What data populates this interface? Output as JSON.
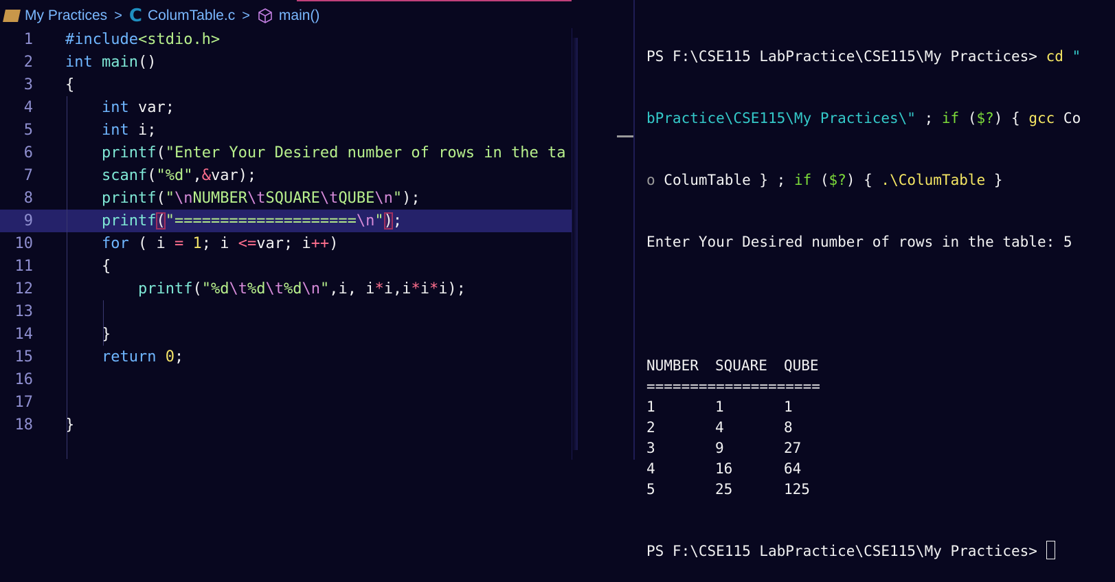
{
  "breadcrumb": {
    "folder": "My Practices",
    "file": "ColumTable.c",
    "symbol": "main()"
  },
  "editor": {
    "highlighted_line": 9,
    "lines": [
      [
        [
          "kw",
          "#include"
        ],
        [
          "str",
          "<stdio.h>"
        ]
      ],
      [
        [
          "kw",
          "int"
        ],
        [
          "pl",
          " "
        ],
        [
          "fn",
          "main"
        ],
        [
          "pl",
          "()"
        ]
      ],
      [
        [
          "pl",
          "{"
        ]
      ],
      [
        [
          "pl",
          "    "
        ],
        [
          "kw",
          "int"
        ],
        [
          "pl",
          " var;"
        ]
      ],
      [
        [
          "pl",
          "    "
        ],
        [
          "kw",
          "int"
        ],
        [
          "pl",
          " i;"
        ]
      ],
      [
        [
          "pl",
          "    "
        ],
        [
          "fn",
          "printf"
        ],
        [
          "pl",
          "("
        ],
        [
          "str",
          "\"Enter Your Desired number of rows in the ta"
        ]
      ],
      [
        [
          "pl",
          "    "
        ],
        [
          "fn",
          "scanf"
        ],
        [
          "pl",
          "("
        ],
        [
          "str",
          "\"%d\""
        ],
        [
          "pl",
          ","
        ],
        [
          "op",
          "&"
        ],
        [
          "pl",
          "var);"
        ]
      ],
      [
        [
          "pl",
          "    "
        ],
        [
          "fn",
          "printf"
        ],
        [
          "pl",
          "("
        ],
        [
          "str",
          "\""
        ],
        [
          "esc",
          "\\n"
        ],
        [
          "str",
          "NUMBER"
        ],
        [
          "esc",
          "\\t"
        ],
        [
          "str",
          "SQUARE"
        ],
        [
          "esc",
          "\\t"
        ],
        [
          "str",
          "QUBE"
        ],
        [
          "esc",
          "\\n"
        ],
        [
          "str",
          "\""
        ],
        [
          "pl",
          ");"
        ]
      ],
      [
        [
          "pl",
          "    "
        ],
        [
          "fn",
          "printf"
        ],
        [
          "br",
          "("
        ],
        [
          "str",
          "\"===================="
        ],
        [
          "esc",
          "\\n"
        ],
        [
          "str",
          "\""
        ],
        [
          "br",
          ")"
        ],
        [
          "pl",
          ";"
        ]
      ],
      [
        [
          "pl",
          "    "
        ],
        [
          "kw",
          "for"
        ],
        [
          "pl",
          " ( i "
        ],
        [
          "op",
          "="
        ],
        [
          "pl",
          " "
        ],
        [
          "num",
          "1"
        ],
        [
          "pl",
          "; i "
        ],
        [
          "op",
          "<="
        ],
        [
          "pl",
          "var; i"
        ],
        [
          "op",
          "++"
        ],
        [
          "pl",
          ")"
        ]
      ],
      [
        [
          "pl",
          "    {"
        ]
      ],
      [
        [
          "pl",
          "        "
        ],
        [
          "fn",
          "printf"
        ],
        [
          "pl",
          "("
        ],
        [
          "str",
          "\"%d"
        ],
        [
          "esc",
          "\\t"
        ],
        [
          "str",
          "%d"
        ],
        [
          "esc",
          "\\t"
        ],
        [
          "str",
          "%d"
        ],
        [
          "esc",
          "\\n"
        ],
        [
          "str",
          "\""
        ],
        [
          "pl",
          ",i, i"
        ],
        [
          "op",
          "*"
        ],
        [
          "pl",
          "i,i"
        ],
        [
          "op",
          "*"
        ],
        [
          "pl",
          "i"
        ],
        [
          "op",
          "*"
        ],
        [
          "pl",
          "i);"
        ]
      ],
      [],
      [
        [
          "pl",
          "    }"
        ]
      ],
      [
        [
          "pl",
          "    "
        ],
        [
          "kw",
          "return"
        ],
        [
          "pl",
          " "
        ],
        [
          "num",
          "0"
        ],
        [
          "pl",
          ";"
        ]
      ],
      [],
      [],
      [
        [
          "pl",
          "}"
        ]
      ]
    ]
  },
  "terminal": {
    "line1": [
      [
        "pl",
        "PS F:\\CSE115 LabPractice\\CSE115\\My Practices> "
      ],
      [
        "yel",
        "cd"
      ],
      [
        "pl",
        " "
      ],
      [
        "cyan",
        "\""
      ]
    ],
    "line2": [
      [
        "cyan",
        "bPractice\\CSE115\\My Practices\\\""
      ],
      [
        "pl",
        " ; "
      ],
      [
        "grn",
        "if"
      ],
      [
        "pl",
        " ("
      ],
      [
        "grn",
        "$?"
      ],
      [
        "pl",
        ") { "
      ],
      [
        "yel",
        "gcc"
      ],
      [
        "pl",
        " Co"
      ]
    ],
    "line3": [
      [
        "gry",
        "o"
      ],
      [
        "pl",
        " ColumTable } ; "
      ],
      [
        "grn",
        "if"
      ],
      [
        "pl",
        " ("
      ],
      [
        "grn",
        "$?"
      ],
      [
        "pl",
        ") { "
      ],
      [
        "yel",
        ".\\ColumTable"
      ],
      [
        "pl",
        " }"
      ]
    ],
    "prompt_output": "Enter Your Desired number of rows in the table: 5",
    "headers": [
      "NUMBER",
      "SQUARE",
      "QUBE"
    ],
    "rule": "====================",
    "rows": [
      [
        "1",
        "1",
        "1"
      ],
      [
        "2",
        "4",
        "8"
      ],
      [
        "3",
        "9",
        "27"
      ],
      [
        "4",
        "16",
        "64"
      ],
      [
        "5",
        "25",
        "125"
      ]
    ],
    "final_prompt": "PS F:\\CSE115 LabPractice\\CSE115\\My Practices> "
  }
}
